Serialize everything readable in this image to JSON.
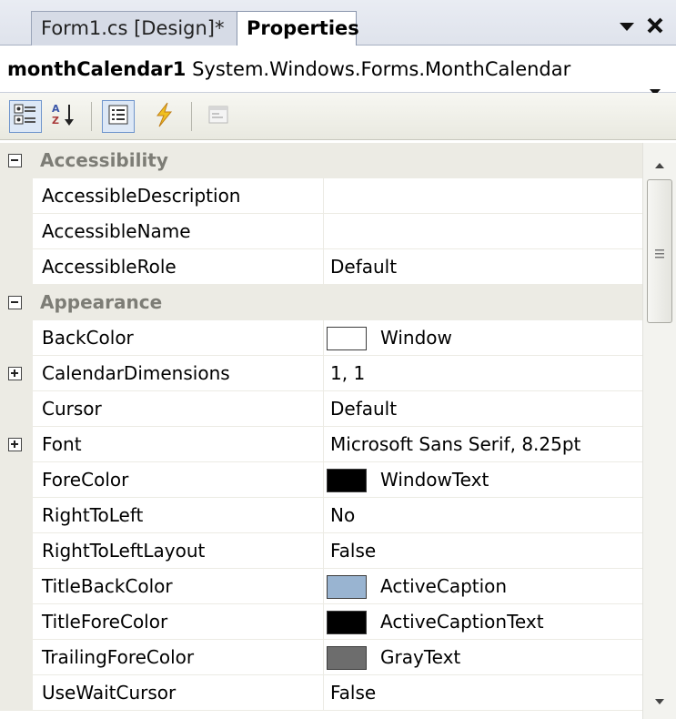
{
  "tabs": [
    {
      "label": "Form1.cs [Design]*"
    },
    {
      "label": "Properties"
    }
  ],
  "object_selector": {
    "name": "monthCalendar1",
    "type": "System.Windows.Forms.MonthCalendar"
  },
  "toolbar": {
    "buttons": [
      "categorized-icon",
      "alphabetical-icon",
      "properties-icon",
      "events-icon",
      "property-pages-icon"
    ],
    "active": "categorized"
  },
  "rows": [
    {
      "kind": "category",
      "label": "Accessibility",
      "expanded": true
    },
    {
      "kind": "prop",
      "name": "AccessibleDescription",
      "value": ""
    },
    {
      "kind": "prop",
      "name": "AccessibleName",
      "value": ""
    },
    {
      "kind": "prop",
      "name": "AccessibleRole",
      "value": "Default"
    },
    {
      "kind": "category",
      "label": "Appearance",
      "expanded": true
    },
    {
      "kind": "prop",
      "name": "BackColor",
      "value": "Window",
      "swatch": "#ffffff"
    },
    {
      "kind": "prop",
      "name": "CalendarDimensions",
      "value": "1, 1",
      "expandable": true
    },
    {
      "kind": "prop",
      "name": "Cursor",
      "value": "Default"
    },
    {
      "kind": "prop",
      "name": "Font",
      "value": "Microsoft Sans Serif, 8.25pt",
      "expandable": true
    },
    {
      "kind": "prop",
      "name": "ForeColor",
      "value": "WindowText",
      "swatch": "#000000"
    },
    {
      "kind": "prop",
      "name": "RightToLeft",
      "value": "No"
    },
    {
      "kind": "prop",
      "name": "RightToLeftLayout",
      "value": "False"
    },
    {
      "kind": "prop",
      "name": "TitleBackColor",
      "value": "ActiveCaption",
      "swatch": "#99b4d1"
    },
    {
      "kind": "prop",
      "name": "TitleForeColor",
      "value": "ActiveCaptionText",
      "swatch": "#000000"
    },
    {
      "kind": "prop",
      "name": "TrailingForeColor",
      "value": "GrayText",
      "swatch": "#6d6d6d"
    },
    {
      "kind": "prop",
      "name": "UseWaitCursor",
      "value": "False"
    }
  ],
  "scrollbar": {
    "position": 0.0
  }
}
